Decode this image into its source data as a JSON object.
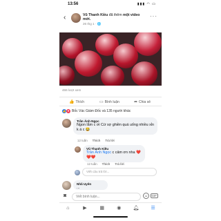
{
  "status_bar": {
    "time": "13:56",
    "signal": "▮▮▮ ◠ ▭"
  },
  "post": {
    "author": "Vũ Thanh Kiều",
    "action_text": "đã thêm",
    "action_bold": "một video mới.",
    "meta": "26 thg 1 · 🌐",
    "views": "466 lượt xem"
  },
  "actions": {
    "like": "Thích",
    "comment": "Bình luận",
    "share": "Chia sẻ"
  },
  "reactions": {
    "summary": "Bốc Vác Giám Đốc và 135 người khác"
  },
  "comments": [
    {
      "name": "Trần Ánh Ngọc",
      "text": "Ngon lắm c ơi Cứ sợ ghiền quá uống nhiều xỉn k á c 😂",
      "time": "12 tuần",
      "like": "Thích",
      "reply": "Trả lời"
    },
    {
      "name": "Vũ Thanh Kiều",
      "tag": "Trần Ánh Ngọc",
      "text": " c cảm ơn nha ❤️❤️❤️",
      "time": "12 tuần",
      "like": "Thích",
      "reply": "Trả lời"
    },
    {
      "name": "Nhã Uyên",
      "text": "..."
    }
  ],
  "reply_placeholder": "Viết câu trả lời...",
  "composer": {
    "placeholder": "Viết bình luận..."
  },
  "colors": {
    "brand": "#1877f2",
    "heart": "#f33e58"
  }
}
